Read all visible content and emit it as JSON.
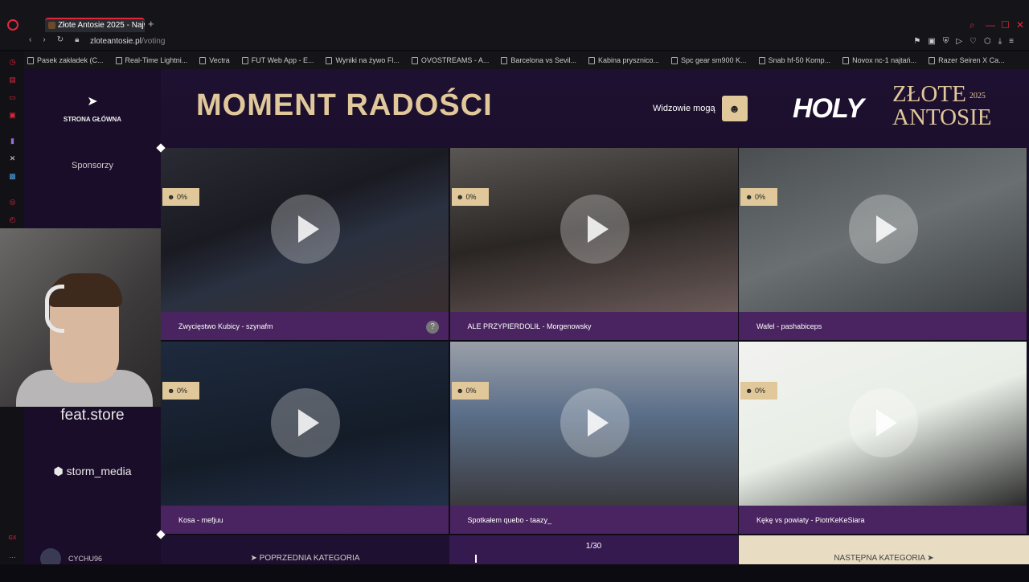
{
  "browser": {
    "tab_title": "Złote Antosie 2025 - Najw",
    "new_tab": "+",
    "url_domain": "zloteantosie.pl",
    "url_path": "/voting",
    "bookmarks": [
      "Pasek zakładek (C...",
      "Real-Time Lightni...",
      "Vectra",
      "FUT Web App - E...",
      "Wyniki na żywo Fl...",
      "OVOSTREAMS - A...",
      "Barcelona vs Sevil...",
      "Kabina prysznico...",
      "Spc gear sm900 K...",
      "Snab hf-50 Komp...",
      "Novox nc-1 najtań...",
      "Razer Seiren X Ca..."
    ]
  },
  "sidebar": {
    "home_label": "STRONA GŁÓWNA",
    "sponsors_label": "Sponsorzy",
    "sponsor_1": "feat.store",
    "sponsor_2": "storm_media",
    "username": "CYCHU96"
  },
  "header": {
    "title": "MOMENT RADOŚCI",
    "viewers_label": "Widzowie mogą",
    "logo_holy": "HOLY",
    "logo_zlote": "ZŁOTE",
    "logo_antosie": "ANTOSIE",
    "logo_year": "2025"
  },
  "cards": [
    {
      "percent": "0%",
      "caption": "Zwycięstwo Kubicy - szynafm",
      "help": "?"
    },
    {
      "percent": "0%",
      "caption": "ALE PRZYPIERDOLIŁ - Morgenowsky"
    },
    {
      "percent": "0%",
      "caption": "Wafel - pashabiceps"
    },
    {
      "percent": "0%",
      "caption": "Kosa - mefjuu"
    },
    {
      "percent": "0%",
      "caption": "Spotkałem quebo - taazy_"
    },
    {
      "percent": "0%",
      "caption": "Kękę vs powiaty - PiotrKeKeSiara"
    }
  ],
  "footer": {
    "prev_label": "POPRZEDNIA KATEGORIA",
    "counter": "1/30",
    "next_label": "NASTĘPNA KATEGORIA"
  },
  "colors": {
    "accent": "#e0c89a",
    "caption_bg": "#4a2460",
    "brand_red": "#e0283d"
  }
}
